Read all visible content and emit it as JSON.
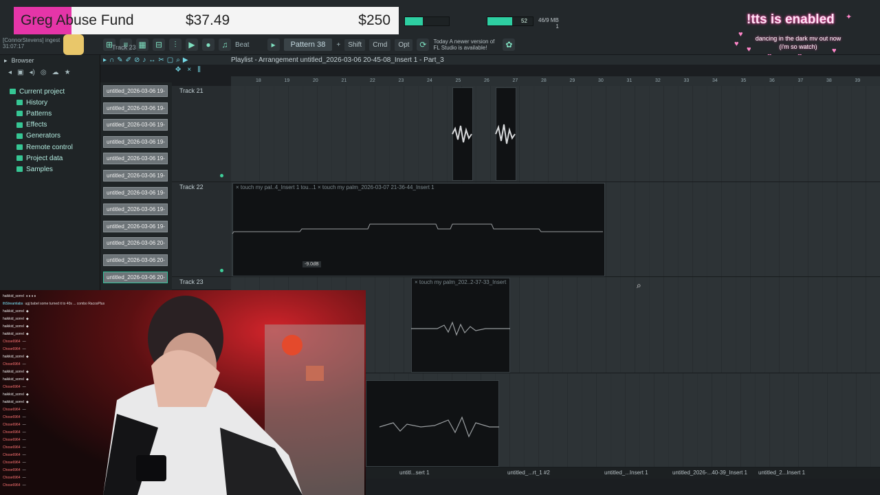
{
  "donation": {
    "name": "Greg Abuse Fund",
    "raised": "$37.49",
    "goal": "$250",
    "progress": 0.15
  },
  "tts": {
    "title": "!tts is enabled",
    "line1": "dancing in the dark mv out now",
    "line2": "(i'm so watch)"
  },
  "stream": {
    "user": "[ConnorStevens] ingest",
    "time": "31:07:17",
    "track_label": "Track 23"
  },
  "toolbar": {
    "beat_label": "Beat",
    "pattern_label": "Pattern 38",
    "shift_label": "Shift",
    "cmd_label": "Cmd",
    "opt_label": "Opt",
    "notice_line1": "Today  A newer version of",
    "notice_line2": "FL Studio is available!",
    "cpu_value": "52",
    "mem_line1": "46/9 MB",
    "mem_line2": "1",
    "cpu_level": 0.4,
    "mem_level": 0.55
  },
  "browser": {
    "title": "Browser",
    "items": [
      {
        "label": "Current project",
        "root": true
      },
      {
        "label": "History"
      },
      {
        "label": "Patterns"
      },
      {
        "label": "Effects"
      },
      {
        "label": "Generators"
      },
      {
        "label": "Remote control"
      },
      {
        "label": "Project data"
      },
      {
        "label": "Samples"
      }
    ]
  },
  "picker": {
    "items": [
      "untitled_2026-03-06 19-",
      "untitled_2026-03-06 19-",
      "untitled_2026-03-06 19-",
      "untitled_2026-03-06 19-",
      "untitled_2026-03-06 19-",
      "untitled_2026-03-06 19-",
      "untitled_2026-03-06 19-",
      "untitled_2026-03-06 19-",
      "untitled_2026-03-06 19-",
      "untitled_2026-03-06 20-",
      "untitled_2026-03-06 20-",
      "untitled_2026-03-06 20-"
    ]
  },
  "playlist": {
    "title": "Playlist - Arrangement  untitled_2026-03-06 20-45-08_Insert 1 - Part_3",
    "ruler": [
      "18",
      "19",
      "20",
      "21",
      "22",
      "23",
      "24",
      "25",
      "26",
      "27",
      "28",
      "29",
      "30",
      "31",
      "32",
      "33",
      "34",
      "35",
      "36",
      "37",
      "38",
      "39"
    ],
    "tracks": [
      {
        "name": "Track 21"
      },
      {
        "name": "Track 22"
      },
      {
        "name": "Track 23"
      }
    ],
    "clip_track22": "× touch my pal..4_Insert 1  tou...1  × touch my palm_2026-03-07 21-36-44_Insert 1",
    "clip_track23": "× touch my palm_202..2-37-33_Insert 1",
    "volume_tip": "-9.0dB",
    "bottom_tabs": [
      "untitl...sert 1",
      "untitled_...rt_1 #2",
      "untitled_...Insert 1",
      "untitled_2026-...40-39_Insert 1",
      "untitled_2...Insert 1"
    ]
  },
  "chat": {
    "messages": [
      {
        "user": "haikkid_sorrel",
        "text": "♦ ♦ ♦ ♦",
        "style": "u1"
      },
      {
        "user": "thStreamlabs",
        "text": "ugj babel some turned it to 40s ... combo RacosPlus",
        "style": "u3"
      },
      {
        "user": "haikkid_sorrel",
        "text": "◆",
        "style": "u1"
      },
      {
        "user": "haikkid_sorrel",
        "text": "◆",
        "style": "u1"
      },
      {
        "user": "haikkid_sorrel",
        "text": "◆",
        "style": "u1"
      },
      {
        "user": "haikkid_sorrel",
        "text": "◆",
        "style": "u1"
      },
      {
        "user": "Chose6964",
        "text": "—",
        "style": "u2"
      },
      {
        "user": "Chose6964",
        "text": "—",
        "style": "u2"
      },
      {
        "user": "haikkid_sorrel",
        "text": "◆",
        "style": "u1"
      },
      {
        "user": "Chose6964",
        "text": "—",
        "style": "u2"
      },
      {
        "user": "haikkid_sorrel",
        "text": "◆",
        "style": "u1"
      },
      {
        "user": "haikkid_sorrel",
        "text": "◆",
        "style": "u1"
      },
      {
        "user": "Chose6964",
        "text": "—",
        "style": "u2"
      },
      {
        "user": "haikkid_sorrel",
        "text": "◆",
        "style": "u1"
      },
      {
        "user": "haikkid_sorrel",
        "text": "◆",
        "style": "u1"
      },
      {
        "user": "Chose6964",
        "text": "—",
        "style": "u2"
      },
      {
        "user": "Chose6964",
        "text": "—",
        "style": "u2"
      },
      {
        "user": "Chose6964",
        "text": "—",
        "style": "u2"
      },
      {
        "user": "Chose6964",
        "text": "—",
        "style": "u2"
      },
      {
        "user": "Chose6964",
        "text": "—",
        "style": "u2"
      },
      {
        "user": "Chose6964",
        "text": "—",
        "style": "u2"
      },
      {
        "user": "Chose6964",
        "text": "—",
        "style": "u2"
      },
      {
        "user": "Chose6964",
        "text": "—",
        "style": "u2"
      },
      {
        "user": "Chose6964",
        "text": "—",
        "style": "u2"
      },
      {
        "user": "Chose6964",
        "text": "—",
        "style": "u2"
      },
      {
        "user": "Chose6964",
        "text": "—",
        "style": "u2"
      }
    ]
  }
}
